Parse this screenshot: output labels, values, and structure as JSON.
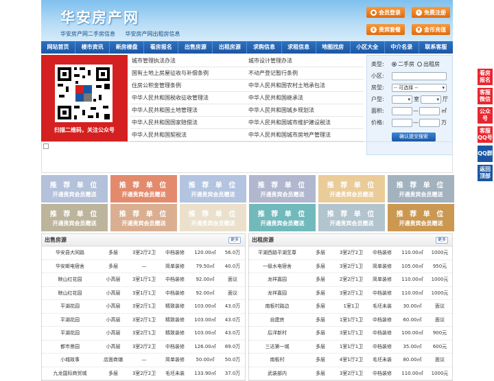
{
  "header": {
    "logo": "华安房产网",
    "sub1": "华安房产网二手房信息",
    "sub2": "华安房产网出租房信息",
    "btn_login": "会员登录",
    "btn_register": "免费注册",
    "btn_package": "贵宾套餐",
    "btn_recharge": "金币充值"
  },
  "nav": [
    "网站首页",
    "楼市资讯",
    "新房楼盘",
    "看房报名",
    "出售房源",
    "出租房源",
    "求购信息",
    "求租信息",
    "地图找房",
    "小区大全",
    "中介名录",
    "联系客服"
  ],
  "qr": {
    "caption": "扫描二维码，关注公众号"
  },
  "links": [
    [
      "城市管理执法办法",
      "城市设计管理办法"
    ],
    [
      "国有土地上房屋征收与补偿条例",
      "不动产登记暂行条例"
    ],
    [
      "住房公积金管理条例",
      "中华人民共和国农村土地承包法"
    ],
    [
      "中华人民共和国税收征收管理法",
      "中华人民共和国继承法"
    ],
    [
      "中华人民共和国土地管理法",
      "中华人民共和国城乡规划法"
    ],
    [
      "中华人民共和国国家赔偿法",
      "中华人民共和国城市维护建设税法"
    ],
    [
      "中华人民共和国契税法",
      "中华人民共和国城市房地产管理法"
    ]
  ],
  "search": {
    "type_label": "类型:",
    "opt1": "二手房",
    "opt2": "出租房",
    "community_label": "小区:",
    "housetype_label": "房型:",
    "housetype_value": "-- 可选择 --",
    "layout_label": "户型:",
    "room_unit": "室",
    "hall_unit": "厅",
    "area_label": "面积:",
    "area_unit": "㎡",
    "price_label": "价格:",
    "price_unit": "万",
    "range_sep": "—",
    "submit": "确认提交搜索"
  },
  "recommend": {
    "title": "推 荐 单 位",
    "sub": "开通贵宾会员赠送",
    "colors": [
      "#a9b9d6",
      "#e07a5a",
      "#a9bcdc",
      "#a7aec8",
      "#e8c58c",
      "#96a8b6",
      "#b5aa8f",
      "#d6a582",
      "#e8dcc5",
      "#5fb0b3",
      "#a8bcc8",
      "#c48a3a"
    ]
  },
  "sale": {
    "title": "出售房源",
    "more": "更多",
    "rows": [
      [
        "华安县大同路",
        "多层",
        "3室2厅2卫",
        "中档装修",
        "120.00㎡",
        "56.0万"
      ],
      [
        "华安邮电宿舍",
        "多层",
        "—",
        "简单装修",
        "79.50㎡",
        "40.0万"
      ],
      [
        "映山红花园",
        "小高层",
        "3室1厅1卫",
        "中档装修",
        "92.00㎡",
        "面议"
      ],
      [
        "映山红花园",
        "小高层",
        "3室1厅1卫",
        "中档装修",
        "92.00㎡",
        "面议"
      ],
      [
        "平湖花园",
        "小高层",
        "3室2厅1卫",
        "精致装修",
        "103.00㎡",
        "43.0万"
      ],
      [
        "平湖花园",
        "小高层",
        "3室2厅1卫",
        "精致装修",
        "103.00㎡",
        "43.0万"
      ],
      [
        "平湖花园",
        "小高层",
        "3室2厅1卫",
        "精致装修",
        "103.00㎡",
        "43.0万"
      ],
      [
        "都市景园",
        "小高层",
        "3室2厅2卫",
        "中档装修",
        "126.00㎡",
        "89.0万"
      ],
      [
        "小城故事",
        "店面商铺",
        "—",
        "简单装修",
        "50.00㎡",
        "50.0万"
      ],
      [
        "九龙国际商贸城",
        "多层",
        "3室2厅2卫",
        "毛坯未装",
        "133.90㎡",
        "37.0万"
      ]
    ]
  },
  "rent": {
    "title": "出租房源",
    "more": "更多",
    "rows": [
      [
        "平湖西路平湖至尊",
        "多层",
        "3室2厅2卫",
        "中档装修",
        "110.00㎡",
        "1000元"
      ],
      [
        "一级水电宿舍",
        "多层",
        "3室2厅1卫",
        "简单装修",
        "105.00㎡",
        "950元"
      ],
      [
        "龙祥嘉园",
        "多层",
        "2室2厅1卫",
        "简单装修",
        "110.00㎡",
        "1000元"
      ],
      [
        "龙祥嘉园",
        "多层",
        "3室2厅1卫",
        "中档装修",
        "110.00㎡",
        "1000元"
      ],
      [
        "南板村路边",
        "多层",
        "1室1卫",
        "毛坯未装",
        "30.00㎡",
        "面议"
      ],
      [
        "自建房",
        "多层",
        "1室1厅1卫",
        "中档装修",
        "60.00㎡",
        "面议"
      ],
      [
        "后洋新村",
        "多层",
        "3室1厅1卫",
        "中档装修",
        "100.00㎡",
        "900元"
      ],
      [
        "三达第一城",
        "多层",
        "1室1厅1卫",
        "中档装修",
        "35.00㎡",
        "600元"
      ],
      [
        "南板村",
        "多层",
        "4室1厅2卫",
        "毛坯未装",
        "80.00㎡",
        "面议"
      ],
      [
        "武装部内",
        "多层",
        "3室2厅1卫",
        "中档装修",
        "110.00㎡",
        "1000元"
      ]
    ]
  },
  "side": [
    {
      "label": "看房报名",
      "color": "#e8262f"
    },
    {
      "label": "客服微信",
      "color": "#e8262f"
    },
    {
      "label": "公众号",
      "color": "#e8262f"
    },
    {
      "label": "客服QQ号",
      "color": "#e8262f"
    },
    {
      "label": "QQ群",
      "color": "#1a56a3"
    },
    {
      "label": "返回顶部",
      "color": "#1a56a3"
    }
  ]
}
